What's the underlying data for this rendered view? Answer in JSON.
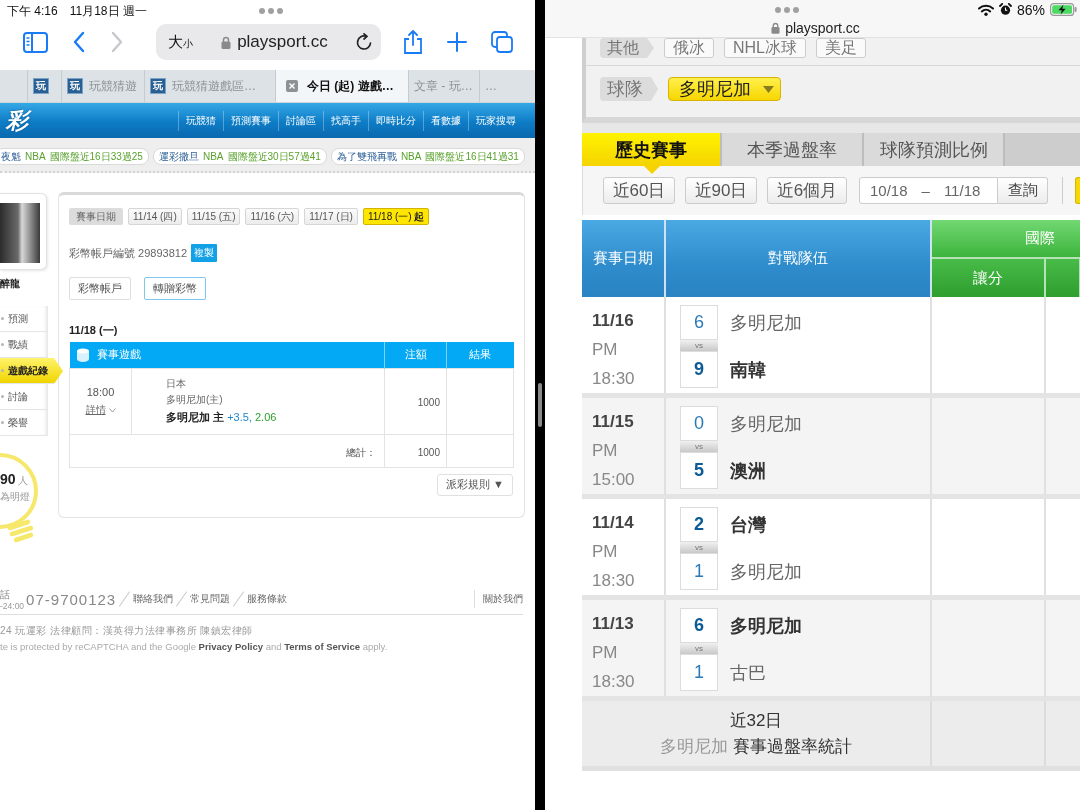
{
  "left_status_bar": {
    "time": "下午 4:16",
    "date": "11月18日 週一"
  },
  "browser_toolbar": {
    "nav_buttons": [
      {
        "kind": "back",
        "disabled": false
      },
      {
        "kind": "forward",
        "disabled": true
      }
    ],
    "text_size_large": "大",
    "text_size_small": "小",
    "url": "playsport.cc"
  },
  "browser_tabs": [
    {
      "favicon": "玩",
      "selected": false
    },
    {
      "favicon": "玩",
      "title": "玩競猜遊",
      "selected": false
    },
    {
      "favicon": "玩",
      "title": "玩競猜遊戲區…",
      "selected": false
    },
    {
      "title": "今日 (起) 遊戲…",
      "selected": true
    },
    {
      "title": "文章 - 玩…",
      "selected": false
    },
    {
      "title": "…",
      "selected": false
    }
  ],
  "site_header": {
    "logo": "彩",
    "nav": [
      "玩競猜",
      "預測賽事",
      "討論區",
      "找高手",
      "即時比分",
      "看數據",
      "玩家搜尋"
    ]
  },
  "ticker": [
    {
      "name": "夜魁",
      "league": "NBA",
      "record": "國際盤近16日33過25"
    },
    {
      "name": "運彩撒旦",
      "league": "NBA",
      "record": "國際盤近30日57過41"
    },
    {
      "name": "為了雙飛再戰",
      "league": "NBA",
      "record": "國際盤近16日41過31"
    }
  ],
  "sidebar": {
    "user_name": "醉龍",
    "menu": [
      {
        "label": "預測",
        "selected": false
      },
      {
        "label": "戰績",
        "selected": false
      },
      {
        "label": "遊戲紀錄",
        "selected": true
      },
      {
        "label": "討論",
        "selected": false
      },
      {
        "label": "榮譽",
        "selected": false
      }
    ],
    "lamp": {
      "count": "90",
      "unit": "人",
      "caption": "為明燈"
    }
  },
  "game_record": {
    "date_filter": {
      "label": "賽事日期",
      "dates": [
        {
          "label": "11/14 (四)",
          "selected": false
        },
        {
          "label": "11/15 (五)",
          "selected": false
        },
        {
          "label": "11/16 (六)",
          "selected": false
        },
        {
          "label": "11/17 (日)",
          "selected": false
        },
        {
          "label": "11/18 (一) **起**",
          "selected": true
        }
      ]
    },
    "account_number": "彩幣帳戶編號 29893812",
    "copy_button": "複製",
    "account_buttons": [
      {
        "label": "彩幣帳戶",
        "selected": false
      },
      {
        "label": "轉贈彩幣",
        "selected": true
      }
    ],
    "day_heading": "11/18 (一)",
    "table": {
      "columns": [
        "賽事遊戲",
        "注額",
        "結果"
      ],
      "rows": [
        {
          "time": "18:00",
          "details": "詳情",
          "league": "日本",
          "match": "多明尼加(主)",
          "pick": "多明尼加 主",
          "line": "+3.5,",
          "odds": "2.06",
          "stake": "1000"
        }
      ],
      "total_label": "總計：",
      "total": "1000"
    },
    "payout_rules": "派彩規則 ▼"
  },
  "footer": {
    "phone_label": "話",
    "hours": "-24:00",
    "phone": "07-9700123",
    "links": [
      "聯絡我們",
      "常見問題",
      "服務條款"
    ],
    "about": "關於我們",
    "legal": "24 玩運彩 法律顧問：漢英得力法律事務所 陳鎮宏律師",
    "recaptcha": "te is protected by reCAPTCHA and the Google **Privacy Policy** and **Terms of Service** apply."
  },
  "right_status_bar": {
    "url": "playsport.cc",
    "battery": "86%"
  },
  "sport_filter": {
    "label": "其他",
    "options": [
      "俄冰",
      "NHL冰球",
      "美足"
    ]
  },
  "team_filter": {
    "label": "球隊",
    "value": "多明尼加"
  },
  "view_tabs": [
    {
      "label": "歷史賽事",
      "selected": true
    },
    {
      "label": "本季過盤率",
      "selected": false
    },
    {
      "label": "球隊預測比例",
      "selected": false
    }
  ],
  "range_buttons": [
    "近60日",
    "近90日",
    "近6個月"
  ],
  "date_range": {
    "from": "10/18",
    "separator": "–",
    "to": "11/18",
    "button": "查詢"
  },
  "history_table": {
    "columns": [
      "賽事日期",
      "對戰隊伍"
    ],
    "group": "國際",
    "sub_columns": [
      "讓分"
    ],
    "rows": [
      {
        "date": "11/16",
        "period": "PM",
        "time": "18:30",
        "vs": "vs",
        "teams": [
          {
            "score": "6",
            "name": "多明尼加",
            "winner": false
          },
          {
            "score": "9",
            "name": "南韓",
            "winner": true
          }
        ]
      },
      {
        "date": "11/15",
        "period": "PM",
        "time": "15:00",
        "vs": "vs",
        "teams": [
          {
            "score": "0",
            "name": "多明尼加",
            "winner": false
          },
          {
            "score": "5",
            "name": "澳洲",
            "winner": true
          }
        ]
      },
      {
        "date": "11/14",
        "period": "PM",
        "time": "18:30",
        "vs": "vs",
        "teams": [
          {
            "score": "2",
            "name": "台灣",
            "winner": true
          },
          {
            "score": "1",
            "name": "多明尼加",
            "winner": false
          }
        ]
      },
      {
        "date": "11/13",
        "period": "PM",
        "time": "18:30",
        "vs": "vs",
        "teams": [
          {
            "score": "6",
            "name": "多明尼加",
            "winner": true
          },
          {
            "score": "1",
            "name": "古巴",
            "winner": false
          }
        ]
      }
    ],
    "summary": {
      "period": "近32日",
      "team": "多明尼加",
      "label": "賽事過盤率統計"
    }
  }
}
